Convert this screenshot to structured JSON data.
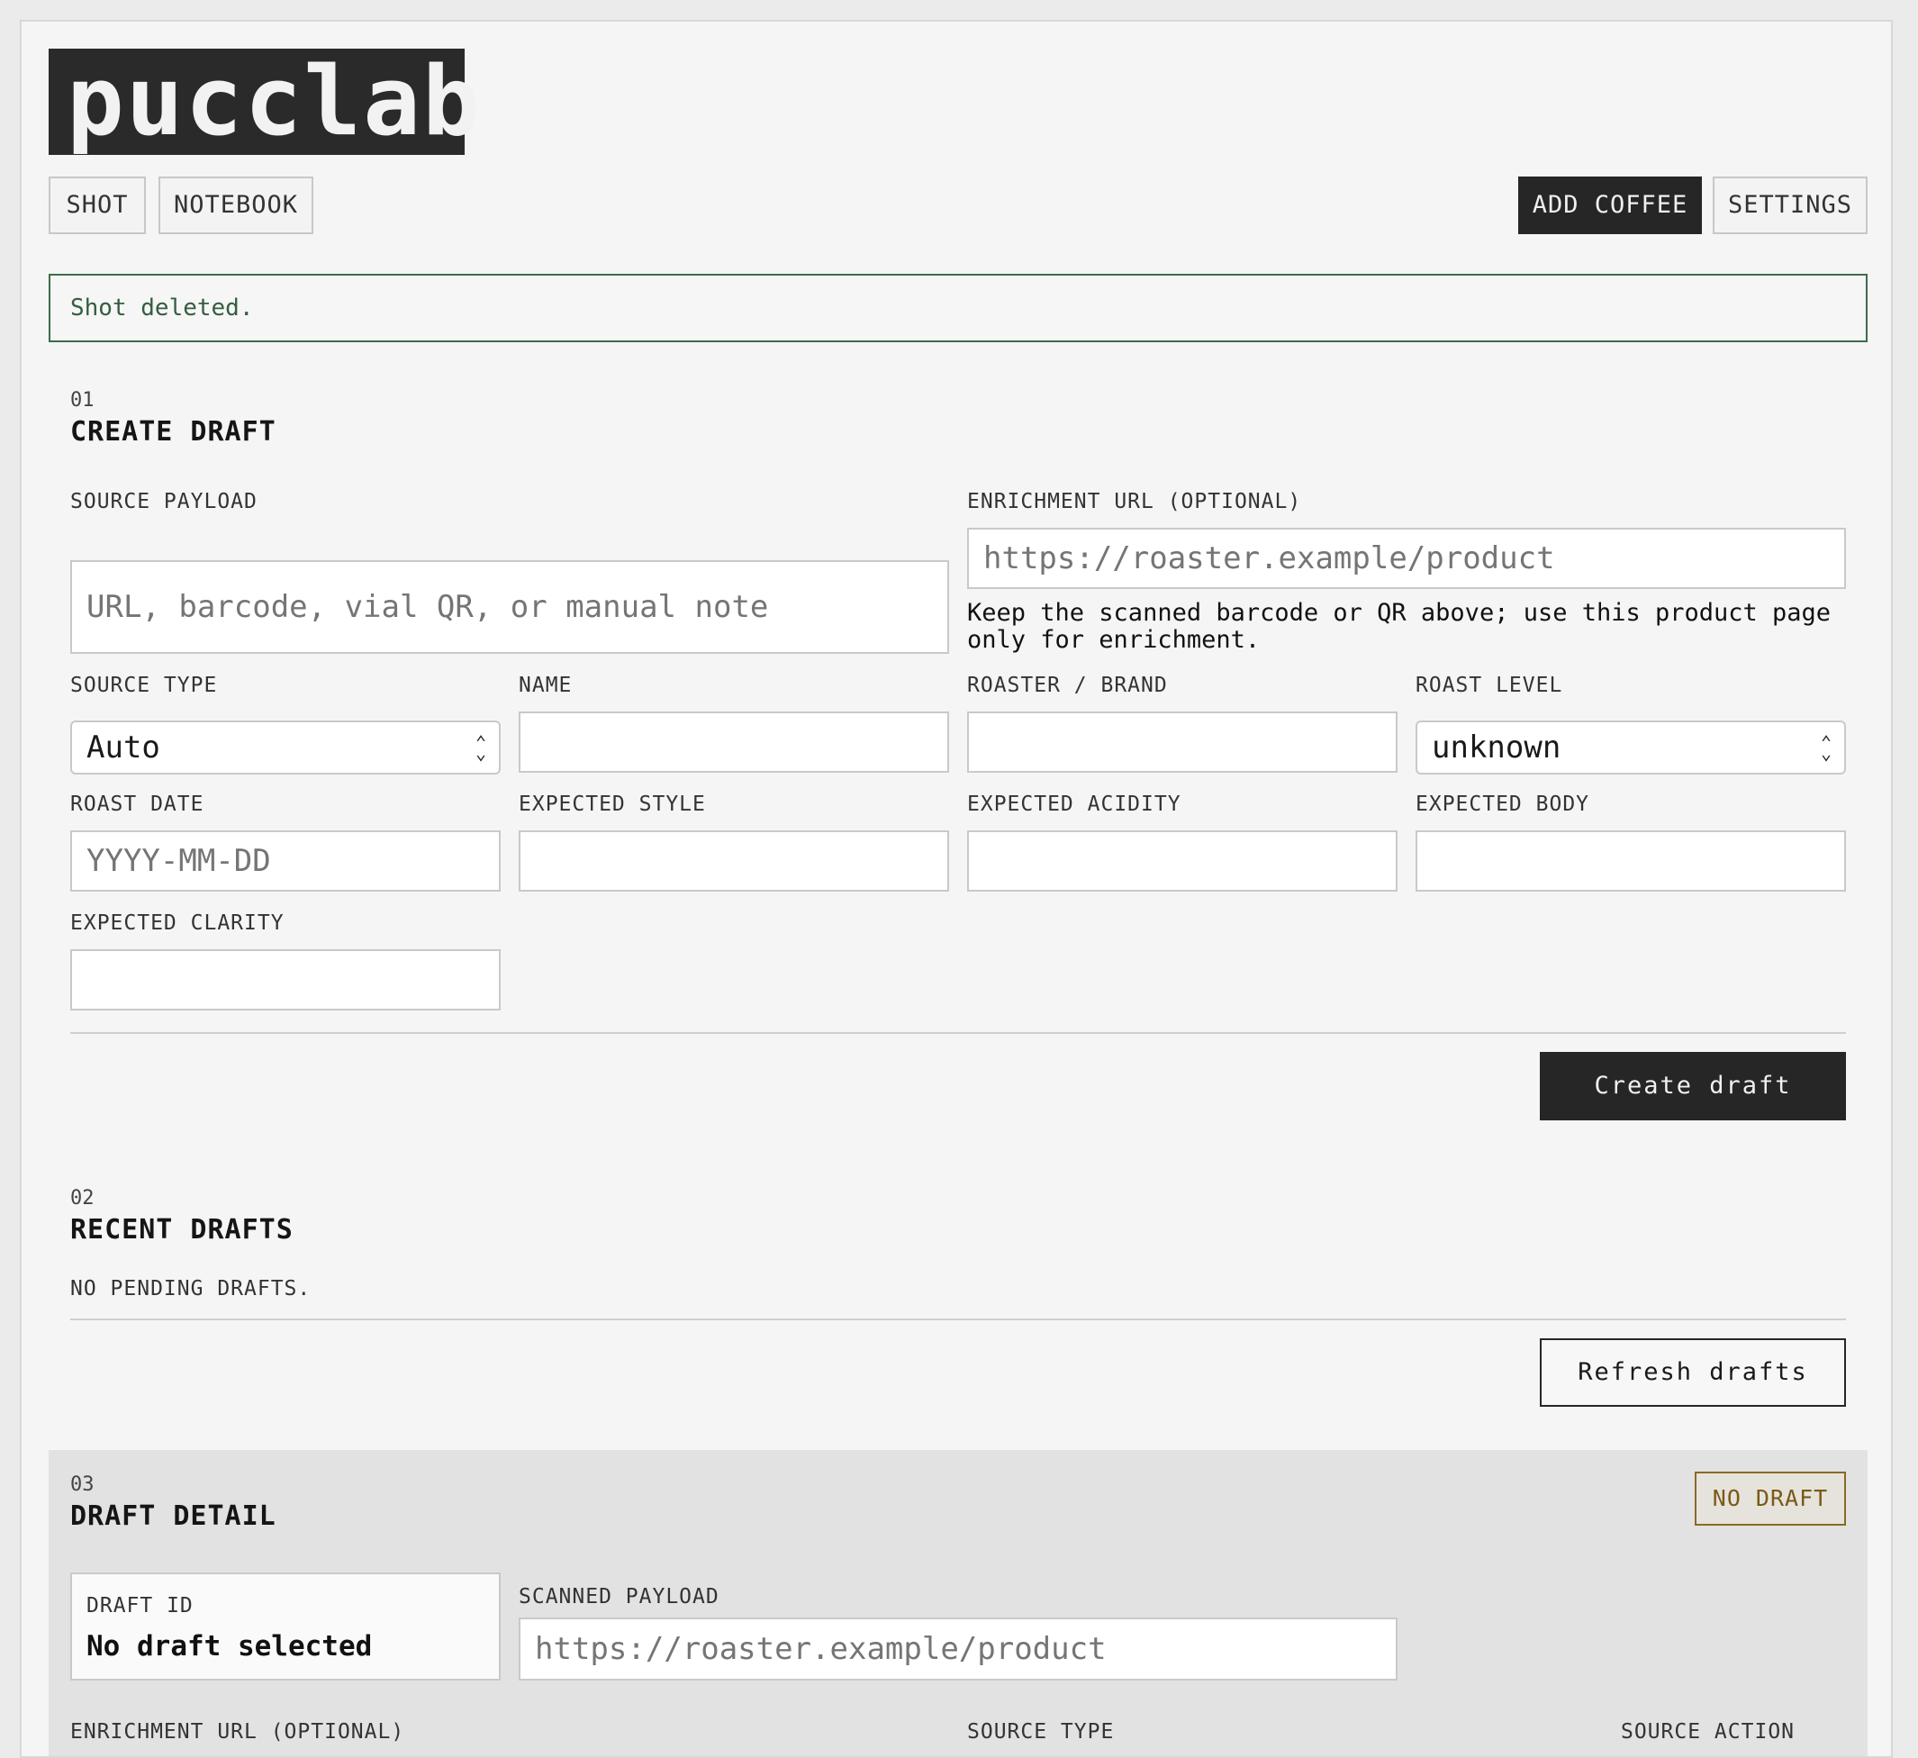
{
  "app": {
    "logo": "pucclab"
  },
  "nav": {
    "shot": "SHOT",
    "notebook": "NOTEBOOK",
    "add_coffee": "ADD COFFEE",
    "settings": "SETTINGS"
  },
  "banner": {
    "message": "Shot deleted."
  },
  "create_draft": {
    "number": "01",
    "title": "CREATE DRAFT",
    "source_payload": {
      "label": "SOURCE PAYLOAD",
      "value": "",
      "placeholder": "URL, barcode, vial QR, or manual note"
    },
    "enrichment_url": {
      "label": "ENRICHMENT URL (OPTIONAL)",
      "value": "",
      "placeholder": "https://roaster.example/product"
    },
    "hint": "Keep the scanned barcode or QR above; use this product page only for enrichment.",
    "source_type": {
      "label": "SOURCE TYPE",
      "selected": "Auto"
    },
    "name": {
      "label": "NAME",
      "value": ""
    },
    "roaster_brand": {
      "label": "ROASTER / BRAND",
      "value": ""
    },
    "roast_level": {
      "label": "ROAST LEVEL",
      "selected": "unknown"
    },
    "roast_date": {
      "label": "ROAST DATE",
      "value": "",
      "placeholder": "YYYY-MM-DD"
    },
    "expected_style": {
      "label": "EXPECTED STYLE",
      "value": ""
    },
    "expected_acidity": {
      "label": "EXPECTED ACIDITY",
      "value": ""
    },
    "expected_body": {
      "label": "EXPECTED BODY",
      "value": ""
    },
    "expected_clarity": {
      "label": "EXPECTED CLARITY",
      "value": ""
    },
    "submit_label": "Create draft"
  },
  "recent_drafts": {
    "number": "02",
    "title": "RECENT DRAFTS",
    "empty_text": "NO PENDING DRAFTS.",
    "refresh_label": "Refresh drafts"
  },
  "draft_detail": {
    "number": "03",
    "title": "DRAFT DETAIL",
    "badge": "NO DRAFT",
    "draft_id": {
      "label": "DRAFT ID",
      "value": "No draft selected"
    },
    "scanned_payload": {
      "label": "SCANNED PAYLOAD",
      "value": "",
      "placeholder": "https://roaster.example/product"
    },
    "enrichment_url_label": "ENRICHMENT URL (OPTIONAL)",
    "source_type_label": "SOURCE TYPE",
    "source_action_label": "SOURCE ACTION"
  },
  "icons": {
    "select_chevron": "chevron-updown-icon"
  },
  "colors": {
    "dark": "#262626",
    "success": "#3e6b4a",
    "warning": "#8a6a22",
    "panel": "#e2e2e2"
  }
}
